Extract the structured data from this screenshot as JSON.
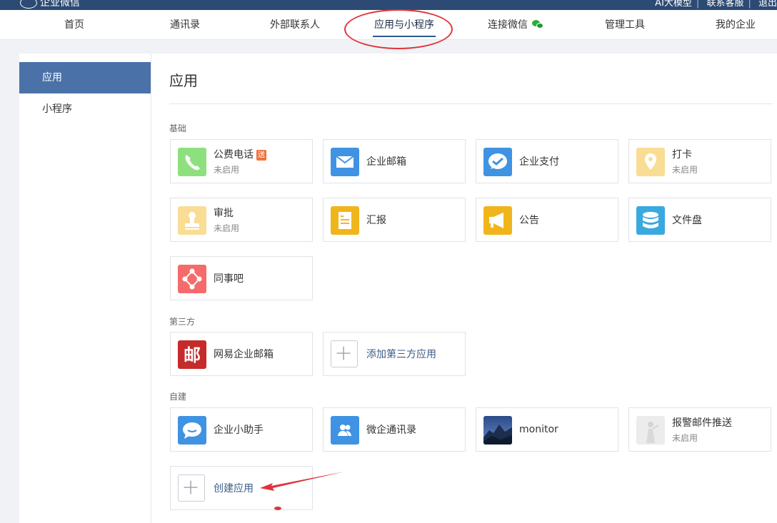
{
  "header": {
    "brand": "企业微信",
    "right_links": [
      "AI大模型",
      "联系客服",
      "退出"
    ]
  },
  "nav": {
    "items": [
      "首页",
      "通讯录",
      "外部联系人",
      "应用与小程序",
      "连接微信",
      "管理工具",
      "我的企业"
    ],
    "active": "应用与小程序"
  },
  "sidebar": {
    "items": [
      "应用",
      "小程序"
    ],
    "active": "应用"
  },
  "main": {
    "title": "应用",
    "sections": {
      "basic": {
        "label": "基础",
        "apps": [
          {
            "name": "公费电话",
            "badge": "送",
            "status": "未启用",
            "icon": "phone-icon",
            "color": "#8ee07f"
          },
          {
            "name": "企业邮箱",
            "icon": "mail-icon",
            "color": "#3f93e2"
          },
          {
            "name": "企业支付",
            "icon": "payment-icon",
            "color": "#3f93e2"
          },
          {
            "name": "打卡",
            "status": "未启用",
            "icon": "location-pin-icon",
            "color": "#f9dd94"
          },
          {
            "name": "审批",
            "status": "未启用",
            "icon": "stamp-icon",
            "color": "#f9dd94"
          },
          {
            "name": "汇报",
            "icon": "report-icon",
            "color": "#f1b51c"
          },
          {
            "name": "公告",
            "icon": "megaphone-icon",
            "color": "#f1b51c"
          },
          {
            "name": "文件盘",
            "icon": "database-icon",
            "color": "#39a9e0"
          },
          {
            "name": "同事吧",
            "icon": "network-icon",
            "color": "#f56b6b"
          }
        ]
      },
      "third_party": {
        "label": "第三方",
        "apps": [
          {
            "name": "网易企业邮箱",
            "icon": "netease-mail-icon",
            "color": "#c62a2a",
            "glyph": "邮"
          },
          {
            "name": "添加第三方应用",
            "icon": "plus-icon",
            "color": "#9aa0a8"
          }
        ]
      },
      "custom": {
        "label": "自建",
        "apps": [
          {
            "name": "企业小助手",
            "icon": "chat-bubble-icon",
            "color": "#3f93e2"
          },
          {
            "name": "微企通讯录",
            "icon": "contacts-icon",
            "color": "#3f93e2"
          },
          {
            "name": "monitor",
            "icon": "mountain-photo-icon",
            "color": "#3d5a8a"
          },
          {
            "name": "报警邮件推送",
            "status": "未启用",
            "icon": "statue-photo-icon",
            "color": "#e8e8e8"
          },
          {
            "name": "创建应用",
            "icon": "plus-icon",
            "color": "#9aa0a8"
          }
        ]
      }
    }
  },
  "annotations": {
    "highlight_color": "#e0333a"
  }
}
